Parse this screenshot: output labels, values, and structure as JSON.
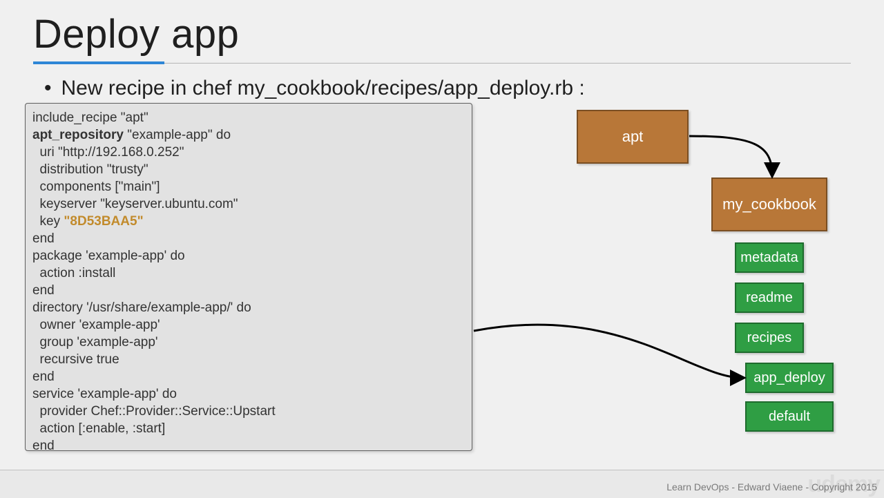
{
  "title": "Deploy app",
  "bullet": "New recipe in chef my_cookbook/recipes/app_deploy.rb :",
  "code": {
    "l1": "include_recipe \"apt\"",
    "l2a": "apt_repository",
    "l2b": " \"example-app\" do",
    "l3": "  uri \"http://192.168.0.252\"",
    "l4": "  distribution \"trusty\"",
    "l5": "  components [\"main\"]",
    "l6": "  keyserver \"keyserver.ubuntu.com\"",
    "l7a": "  key ",
    "l7b": "\"8D53BAA5\"",
    "l8": "end",
    "l9": "package 'example-app' do",
    "l10": "  action :install",
    "l11": "end",
    "l12": "directory '/usr/share/example-app/' do",
    "l13": "  owner 'example-app'",
    "l14": "  group 'example-app'",
    "l15": "  recursive true",
    "l16": "end",
    "l17": "service 'example-app' do",
    "l18": "  provider Chef::Provider::Service::Upstart",
    "l19": "  action [:enable, :start]",
    "l20": "end"
  },
  "diagram": {
    "apt": "apt",
    "cookbook": "my_cookbook",
    "metadata": "metadata",
    "readme": "readme",
    "recipes": "recipes",
    "app_deploy": "app_deploy",
    "default": "default"
  },
  "footer": {
    "copyright": "Learn DevOps - Edward Viaene - Copyright 2015",
    "watermark": "udemy"
  }
}
